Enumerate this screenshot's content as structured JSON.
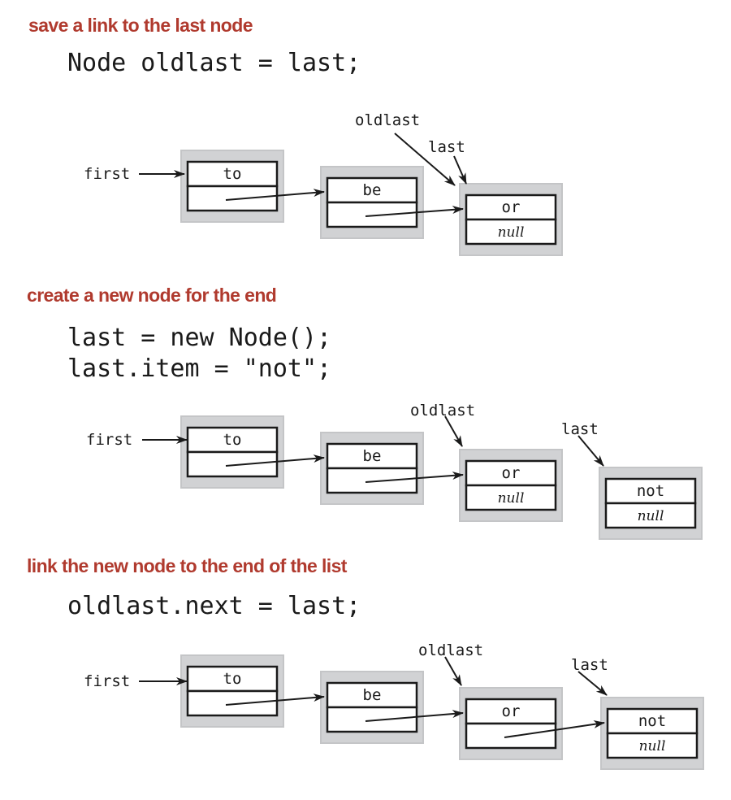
{
  "colors": {
    "heading": "#b03a2e",
    "node_fill": "#d1d2d4",
    "node_border": "#c4c5c7",
    "ink": "#1a1a1a"
  },
  "steps": [
    {
      "heading": "save a link to the last node",
      "code": [
        "Node oldlast = last;"
      ],
      "diagram": {
        "labels": {
          "first": "first",
          "oldlast": "oldlast",
          "last": "last"
        },
        "nodes": [
          {
            "item": "to",
            "next": "be"
          },
          {
            "item": "be",
            "next": "or"
          },
          {
            "item": "or",
            "next": "null"
          }
        ],
        "first_points_to": "to",
        "oldlast_points_to": "or",
        "last_points_to": "or"
      }
    },
    {
      "heading": "create a new node for the end",
      "code": [
        "last = new Node();",
        "last.item = \"not\";"
      ],
      "diagram": {
        "labels": {
          "first": "first",
          "oldlast": "oldlast",
          "last": "last"
        },
        "nodes": [
          {
            "item": "to",
            "next": "be"
          },
          {
            "item": "be",
            "next": "or"
          },
          {
            "item": "or",
            "next": "null"
          },
          {
            "item": "not",
            "next": "null"
          }
        ],
        "first_points_to": "to",
        "oldlast_points_to": "or",
        "last_points_to": "not"
      }
    },
    {
      "heading": "link the new node to the end of the list",
      "code": [
        "oldlast.next = last;"
      ],
      "diagram": {
        "labels": {
          "first": "first",
          "oldlast": "oldlast",
          "last": "last"
        },
        "nodes": [
          {
            "item": "to",
            "next": "be"
          },
          {
            "item": "be",
            "next": "or"
          },
          {
            "item": "or",
            "next": "not"
          },
          {
            "item": "not",
            "next": "null"
          }
        ],
        "first_points_to": "to",
        "oldlast_points_to": "or",
        "last_points_to": "not"
      }
    }
  ],
  "null_label": "null"
}
